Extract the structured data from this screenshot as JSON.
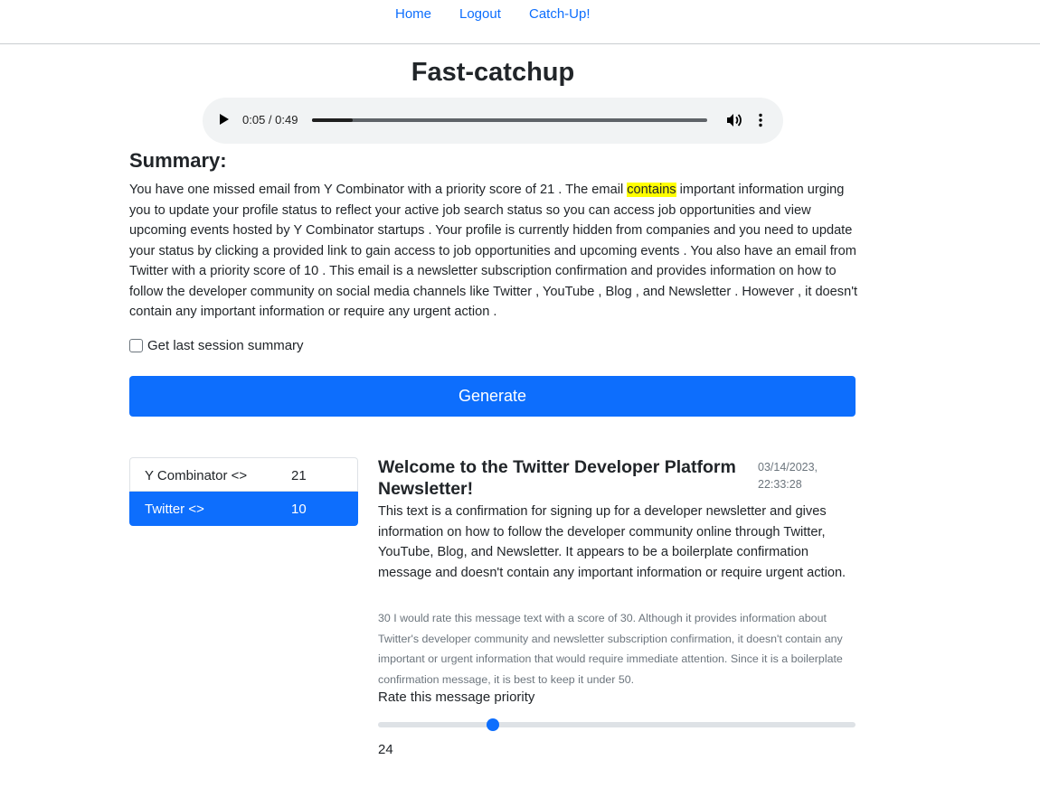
{
  "nav": {
    "home": "Home",
    "logout": "Logout",
    "catchup": "Catch-Up!"
  },
  "page": {
    "title": "Fast-catchup"
  },
  "audio": {
    "time": "0:05 / 0:49",
    "progress": 0.102,
    "play_icon": "play-icon",
    "volume_icon": "volume-icon",
    "menu_icon": "more-vert-icon"
  },
  "summary": {
    "heading": "Summary:",
    "text_before": "You have one missed email from Y Combinator with a priority score of 21 . The email ",
    "highlight": "contains",
    "text_after": " important information urging you to update your profile status to reflect your active job search status so you can access job opportunities and view upcoming events hosted by Y Combinator startups . Your profile is currently hidden from companies and you need to update your status by clicking a provided link to gain access to job opportunities and upcoming events . You also have an email from Twitter with a priority score of 10 . This email is a newsletter subscription confirmation and provides information on how to follow the developer community on social media channels like Twitter , YouTube , Blog , and Newsletter . However , it doesn't contain any important information or require any urgent action .",
    "highlight_color": "#ffff00"
  },
  "checkbox": {
    "label": "Get last session summary",
    "checked": false
  },
  "generate": {
    "label": "Generate",
    "color": "#0d6efd"
  },
  "emails": [
    {
      "name": "Y Combinator <>",
      "score": "21",
      "active": false
    },
    {
      "name": "Twitter <>",
      "score": "10",
      "active": true
    }
  ],
  "detail": {
    "title": "Welcome to the Twitter Developer Platform Newsletter!",
    "date": "03/14/2023, 22:33:28",
    "body": "This text is a confirmation for signing up for a developer newsletter and gives information on how to follow the developer community online through Twitter, YouTube, Blog, and Newsletter. It appears to be a boilerplate confirmation message and doesn't contain any important information or require urgent action.",
    "note": "30 I would rate this message text with a score of 30. Although it provides information about Twitter's developer community and newsletter subscription confirmation, it doesn't contain any important or urgent information that would require immediate attention. Since it is a boilerplate confirmation message, it is best to keep it under 50.",
    "rate_label": "Rate this message priority",
    "rate_value": "24",
    "rate_fraction": 0.24
  }
}
